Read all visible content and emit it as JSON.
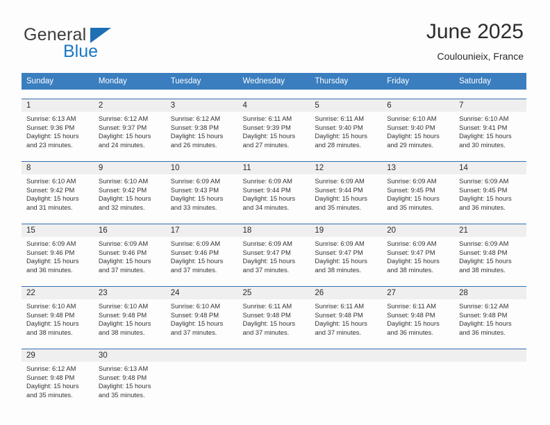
{
  "brand": {
    "name_top": "General",
    "name_bottom": "Blue",
    "triangle_color": "#1878c4",
    "bottom_color": "#1878c4"
  },
  "header": {
    "title": "June 2025",
    "location": "Coulounieix, France"
  },
  "theme": {
    "header_bg": "#3a7ebf",
    "rule_color": "#2f6fb0",
    "daynum_bg": "#efefef",
    "page_bg": "#fdfdfd",
    "text": "#333333"
  },
  "labels": {
    "sunrise": "Sunrise:",
    "sunset": "Sunset:",
    "daylight": "Daylight:"
  },
  "weekdays": [
    "Sunday",
    "Monday",
    "Tuesday",
    "Wednesday",
    "Thursday",
    "Friday",
    "Saturday"
  ],
  "weeks": [
    [
      {
        "day": "1",
        "sunrise": "Sunrise: 6:13 AM",
        "sunset": "Sunset: 9:36 PM",
        "daylight1": "Daylight: 15 hours",
        "daylight2": "and 23 minutes."
      },
      {
        "day": "2",
        "sunrise": "Sunrise: 6:12 AM",
        "sunset": "Sunset: 9:37 PM",
        "daylight1": "Daylight: 15 hours",
        "daylight2": "and 24 minutes."
      },
      {
        "day": "3",
        "sunrise": "Sunrise: 6:12 AM",
        "sunset": "Sunset: 9:38 PM",
        "daylight1": "Daylight: 15 hours",
        "daylight2": "and 26 minutes."
      },
      {
        "day": "4",
        "sunrise": "Sunrise: 6:11 AM",
        "sunset": "Sunset: 9:39 PM",
        "daylight1": "Daylight: 15 hours",
        "daylight2": "and 27 minutes."
      },
      {
        "day": "5",
        "sunrise": "Sunrise: 6:11 AM",
        "sunset": "Sunset: 9:40 PM",
        "daylight1": "Daylight: 15 hours",
        "daylight2": "and 28 minutes."
      },
      {
        "day": "6",
        "sunrise": "Sunrise: 6:10 AM",
        "sunset": "Sunset: 9:40 PM",
        "daylight1": "Daylight: 15 hours",
        "daylight2": "and 29 minutes."
      },
      {
        "day": "7",
        "sunrise": "Sunrise: 6:10 AM",
        "sunset": "Sunset: 9:41 PM",
        "daylight1": "Daylight: 15 hours",
        "daylight2": "and 30 minutes."
      }
    ],
    [
      {
        "day": "8",
        "sunrise": "Sunrise: 6:10 AM",
        "sunset": "Sunset: 9:42 PM",
        "daylight1": "Daylight: 15 hours",
        "daylight2": "and 31 minutes."
      },
      {
        "day": "9",
        "sunrise": "Sunrise: 6:10 AM",
        "sunset": "Sunset: 9:42 PM",
        "daylight1": "Daylight: 15 hours",
        "daylight2": "and 32 minutes."
      },
      {
        "day": "10",
        "sunrise": "Sunrise: 6:09 AM",
        "sunset": "Sunset: 9:43 PM",
        "daylight1": "Daylight: 15 hours",
        "daylight2": "and 33 minutes."
      },
      {
        "day": "11",
        "sunrise": "Sunrise: 6:09 AM",
        "sunset": "Sunset: 9:44 PM",
        "daylight1": "Daylight: 15 hours",
        "daylight2": "and 34 minutes."
      },
      {
        "day": "12",
        "sunrise": "Sunrise: 6:09 AM",
        "sunset": "Sunset: 9:44 PM",
        "daylight1": "Daylight: 15 hours",
        "daylight2": "and 35 minutes."
      },
      {
        "day": "13",
        "sunrise": "Sunrise: 6:09 AM",
        "sunset": "Sunset: 9:45 PM",
        "daylight1": "Daylight: 15 hours",
        "daylight2": "and 35 minutes."
      },
      {
        "day": "14",
        "sunrise": "Sunrise: 6:09 AM",
        "sunset": "Sunset: 9:45 PM",
        "daylight1": "Daylight: 15 hours",
        "daylight2": "and 36 minutes."
      }
    ],
    [
      {
        "day": "15",
        "sunrise": "Sunrise: 6:09 AM",
        "sunset": "Sunset: 9:46 PM",
        "daylight1": "Daylight: 15 hours",
        "daylight2": "and 36 minutes."
      },
      {
        "day": "16",
        "sunrise": "Sunrise: 6:09 AM",
        "sunset": "Sunset: 9:46 PM",
        "daylight1": "Daylight: 15 hours",
        "daylight2": "and 37 minutes."
      },
      {
        "day": "17",
        "sunrise": "Sunrise: 6:09 AM",
        "sunset": "Sunset: 9:46 PM",
        "daylight1": "Daylight: 15 hours",
        "daylight2": "and 37 minutes."
      },
      {
        "day": "18",
        "sunrise": "Sunrise: 6:09 AM",
        "sunset": "Sunset: 9:47 PM",
        "daylight1": "Daylight: 15 hours",
        "daylight2": "and 37 minutes."
      },
      {
        "day": "19",
        "sunrise": "Sunrise: 6:09 AM",
        "sunset": "Sunset: 9:47 PM",
        "daylight1": "Daylight: 15 hours",
        "daylight2": "and 38 minutes."
      },
      {
        "day": "20",
        "sunrise": "Sunrise: 6:09 AM",
        "sunset": "Sunset: 9:47 PM",
        "daylight1": "Daylight: 15 hours",
        "daylight2": "and 38 minutes."
      },
      {
        "day": "21",
        "sunrise": "Sunrise: 6:09 AM",
        "sunset": "Sunset: 9:48 PM",
        "daylight1": "Daylight: 15 hours",
        "daylight2": "and 38 minutes."
      }
    ],
    [
      {
        "day": "22",
        "sunrise": "Sunrise: 6:10 AM",
        "sunset": "Sunset: 9:48 PM",
        "daylight1": "Daylight: 15 hours",
        "daylight2": "and 38 minutes."
      },
      {
        "day": "23",
        "sunrise": "Sunrise: 6:10 AM",
        "sunset": "Sunset: 9:48 PM",
        "daylight1": "Daylight: 15 hours",
        "daylight2": "and 38 minutes."
      },
      {
        "day": "24",
        "sunrise": "Sunrise: 6:10 AM",
        "sunset": "Sunset: 9:48 PM",
        "daylight1": "Daylight: 15 hours",
        "daylight2": "and 37 minutes."
      },
      {
        "day": "25",
        "sunrise": "Sunrise: 6:11 AM",
        "sunset": "Sunset: 9:48 PM",
        "daylight1": "Daylight: 15 hours",
        "daylight2": "and 37 minutes."
      },
      {
        "day": "26",
        "sunrise": "Sunrise: 6:11 AM",
        "sunset": "Sunset: 9:48 PM",
        "daylight1": "Daylight: 15 hours",
        "daylight2": "and 37 minutes."
      },
      {
        "day": "27",
        "sunrise": "Sunrise: 6:11 AM",
        "sunset": "Sunset: 9:48 PM",
        "daylight1": "Daylight: 15 hours",
        "daylight2": "and 36 minutes."
      },
      {
        "day": "28",
        "sunrise": "Sunrise: 6:12 AM",
        "sunset": "Sunset: 9:48 PM",
        "daylight1": "Daylight: 15 hours",
        "daylight2": "and 36 minutes."
      }
    ],
    [
      {
        "day": "29",
        "sunrise": "Sunrise: 6:12 AM",
        "sunset": "Sunset: 9:48 PM",
        "daylight1": "Daylight: 15 hours",
        "daylight2": "and 35 minutes."
      },
      {
        "day": "30",
        "sunrise": "Sunrise: 6:13 AM",
        "sunset": "Sunset: 9:48 PM",
        "daylight1": "Daylight: 15 hours",
        "daylight2": "and 35 minutes."
      },
      {
        "day": "",
        "sunrise": "",
        "sunset": "",
        "daylight1": "",
        "daylight2": ""
      },
      {
        "day": "",
        "sunrise": "",
        "sunset": "",
        "daylight1": "",
        "daylight2": ""
      },
      {
        "day": "",
        "sunrise": "",
        "sunset": "",
        "daylight1": "",
        "daylight2": ""
      },
      {
        "day": "",
        "sunrise": "",
        "sunset": "",
        "daylight1": "",
        "daylight2": ""
      },
      {
        "day": "",
        "sunrise": "",
        "sunset": "",
        "daylight1": "",
        "daylight2": ""
      }
    ]
  ]
}
